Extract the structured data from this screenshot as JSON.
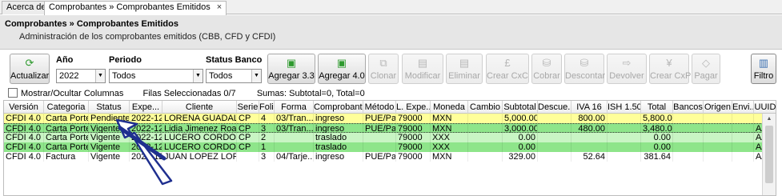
{
  "tabs": [
    {
      "label": "Acerca de",
      "active": false
    },
    {
      "label": "Comprobantes » Comprobantes Emitidos",
      "active": true,
      "close": "×"
    }
  ],
  "header": {
    "title": "Comprobantes » Comprobantes Emitidos",
    "subtitle": "Administración de los comprobantes emitidos (CBB, CFD y CFDI)"
  },
  "toolbar": {
    "actualizar": "Actualizar",
    "anio_label": "Año",
    "anio_value": "2022",
    "periodo_label": "Periodo",
    "periodo_value": "Todos",
    "status_label": "Status Banco",
    "status_value": "Todos",
    "agregar33": "Agregar 3.3",
    "agregar40": "Agregar 4.0",
    "clonar": "Clonar",
    "modificar": "Modificar",
    "eliminar": "Eliminar",
    "crear_cxc": "Crear CxC",
    "cobrar": "Cobrar",
    "descontar": "Descontar",
    "devolver": "Devolver",
    "crear_cxp": "Crear CxP",
    "pagar": "Pagar",
    "filtro": "Filtro"
  },
  "options": {
    "mostrar": "Mostrar/Ocultar Columnas",
    "filas": "Filas Seleccionadas 0/7",
    "sumas": "Sumas: Subtotal=0, Total=0"
  },
  "grid": {
    "columns": [
      "Versión",
      "Categoria",
      "Status",
      "Expe...",
      "Cliente",
      "Serie",
      "Folio",
      "Forma",
      "Comprobante",
      "Método",
      "L. Expe...",
      "Moneda",
      "Cambio",
      "Subtotal",
      "Descue...",
      "IVA 16",
      "ISH 1.50",
      "Total",
      "Bancos",
      "Origen",
      "Envi...",
      "UUID"
    ],
    "rows": [
      [
        "CFDI 4.0",
        "Carta Porte",
        "Pendiente",
        "2022-12...",
        "LORENA GUADAL...",
        "CP",
        "4",
        "03/Tran...",
        "ingreso",
        "PUE/Pa...",
        "79000",
        "MXN",
        "",
        "5,000.00",
        "",
        "800.00",
        "",
        "5,800.00",
        "",
        "",
        "",
        ""
      ],
      [
        "CFDI 4.0",
        "Carta Porte",
        "Vigente",
        "2022-12...",
        "Lidia Jimenez Roa",
        "CP",
        "3",
        "03/Tran...",
        "ingreso",
        "PUE/Pa...",
        "79000",
        "MXN",
        "",
        "3,000.00",
        "",
        "480.00",
        "",
        "3,480.00",
        "",
        "",
        "",
        "AA..."
      ],
      [
        "CFDI 4.0",
        "Carta Porte",
        "Vigente",
        "2022-12...",
        "LUCERO CORDOV...",
        "CP",
        "2",
        "",
        "traslado",
        "",
        "79000",
        "XXX",
        "",
        "0.00",
        "",
        "",
        "",
        "0.00",
        "",
        "",
        "",
        "AA..."
      ],
      [
        "CFDI 4.0",
        "Carta Porte",
        "Vigente",
        "2022-12...",
        "LUCERO CORDOV...",
        "CP",
        "1",
        "",
        "traslado",
        "",
        "79000",
        "XXX",
        "",
        "0.00",
        "",
        "",
        "",
        "0.00",
        "",
        "",
        "",
        "AA..."
      ],
      [
        "CFDI 4.0",
        "Factura",
        "Vigente",
        "2022-12...",
        "JUAN LOPEZ LOPEZ A",
        "",
        "3",
        "04/Tarje...",
        "ingreso",
        "PUE/Pa...",
        "79000",
        "MXN",
        "",
        "329.00",
        "",
        "52.64",
        "",
        "381.64",
        "",
        "",
        "",
        "AA..."
      ]
    ]
  },
  "colors": {
    "pending_row": "#ffff9a",
    "vigente_row": "#8ee58a",
    "vigente_row_alt": "#c9f5c4",
    "arrow": "#1f2f8f"
  }
}
